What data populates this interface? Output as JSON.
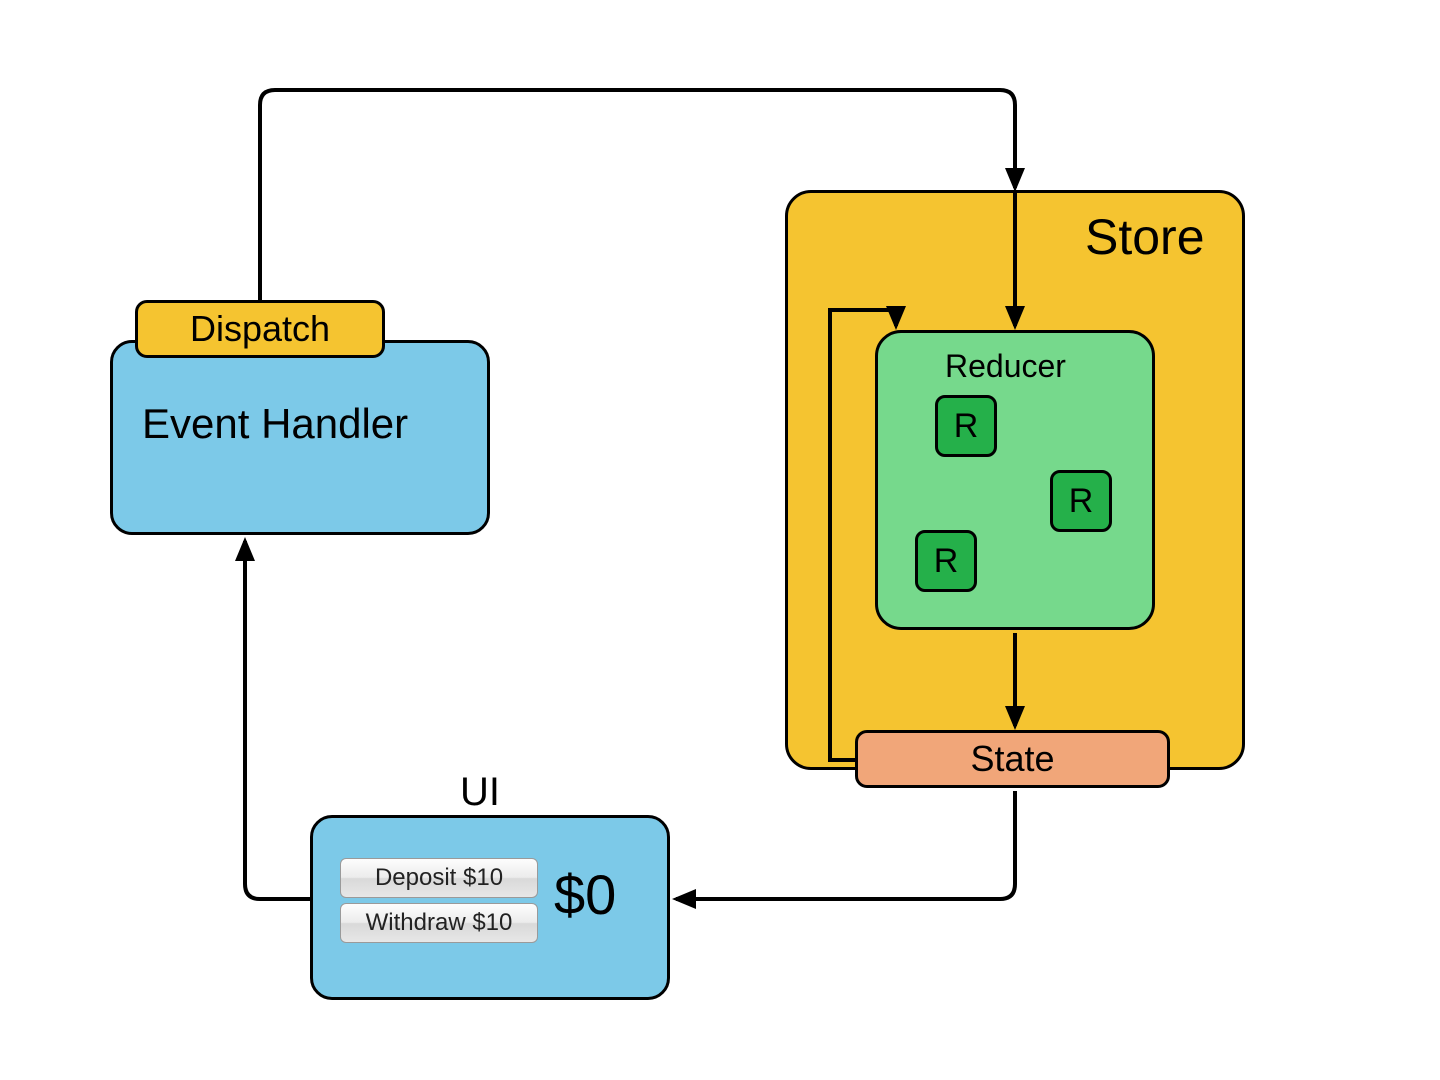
{
  "store": {
    "label": "Store"
  },
  "reducer": {
    "label": "Reducer",
    "r1": "R",
    "r2": "R",
    "r3": "R"
  },
  "state": {
    "label": "State"
  },
  "event_handler": {
    "label": "Event Handler"
  },
  "dispatch": {
    "label": "Dispatch"
  },
  "ui": {
    "label": "UI",
    "deposit": "Deposit $10",
    "withdraw": "Withdraw $10",
    "amount": "$0"
  }
}
